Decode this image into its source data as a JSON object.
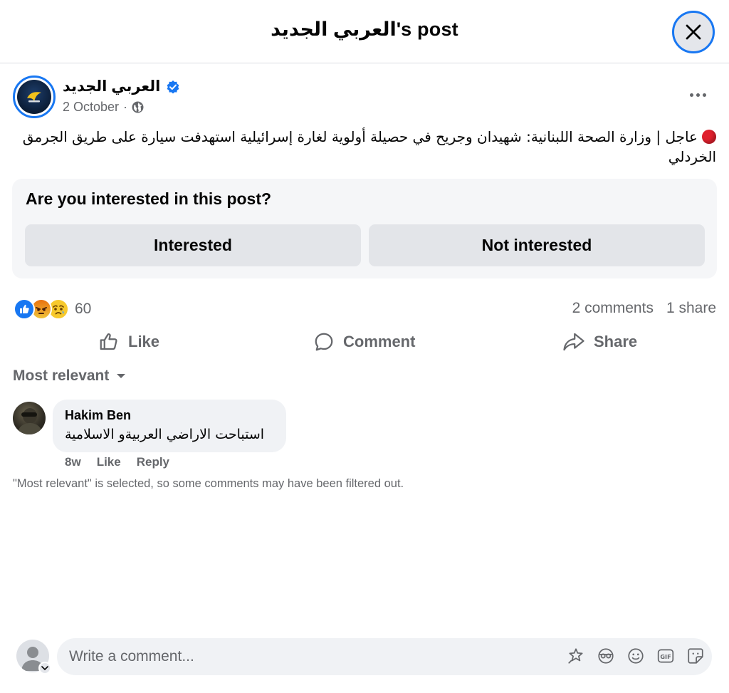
{
  "header": {
    "title": "العربي الجديد's post"
  },
  "post": {
    "page_name": "العربي الجديد",
    "date": "2 October",
    "separator": "·",
    "body": "عاجل |  وزارة الصحة اللبنانية: شهيدان وجريح في حصيلة أولوية لغارة إسرائيلية استهدفت سيارة على طريق الجرمق الخردلي"
  },
  "interest": {
    "question": "Are you interested in this post?",
    "interested_label": "Interested",
    "not_interested_label": "Not interested"
  },
  "stats": {
    "reaction_count": "60",
    "comments": "2 comments",
    "shares": "1 share"
  },
  "actions": {
    "like": "Like",
    "comment": "Comment",
    "share": "Share"
  },
  "sort": {
    "label": "Most relevant"
  },
  "comments": [
    {
      "author": "Hakim Ben",
      "text": "استباحت الاراضي العربيةو الاسلامية",
      "age": "8w",
      "like": "Like",
      "reply": "Reply"
    }
  ],
  "filter_note": "\"Most relevant\" is selected, so some comments may have been filtered out.",
  "composer": {
    "placeholder": "Write a comment..."
  },
  "colors": {
    "accent": "#1877f2",
    "muted": "#65676b",
    "red": "#e0202d"
  }
}
